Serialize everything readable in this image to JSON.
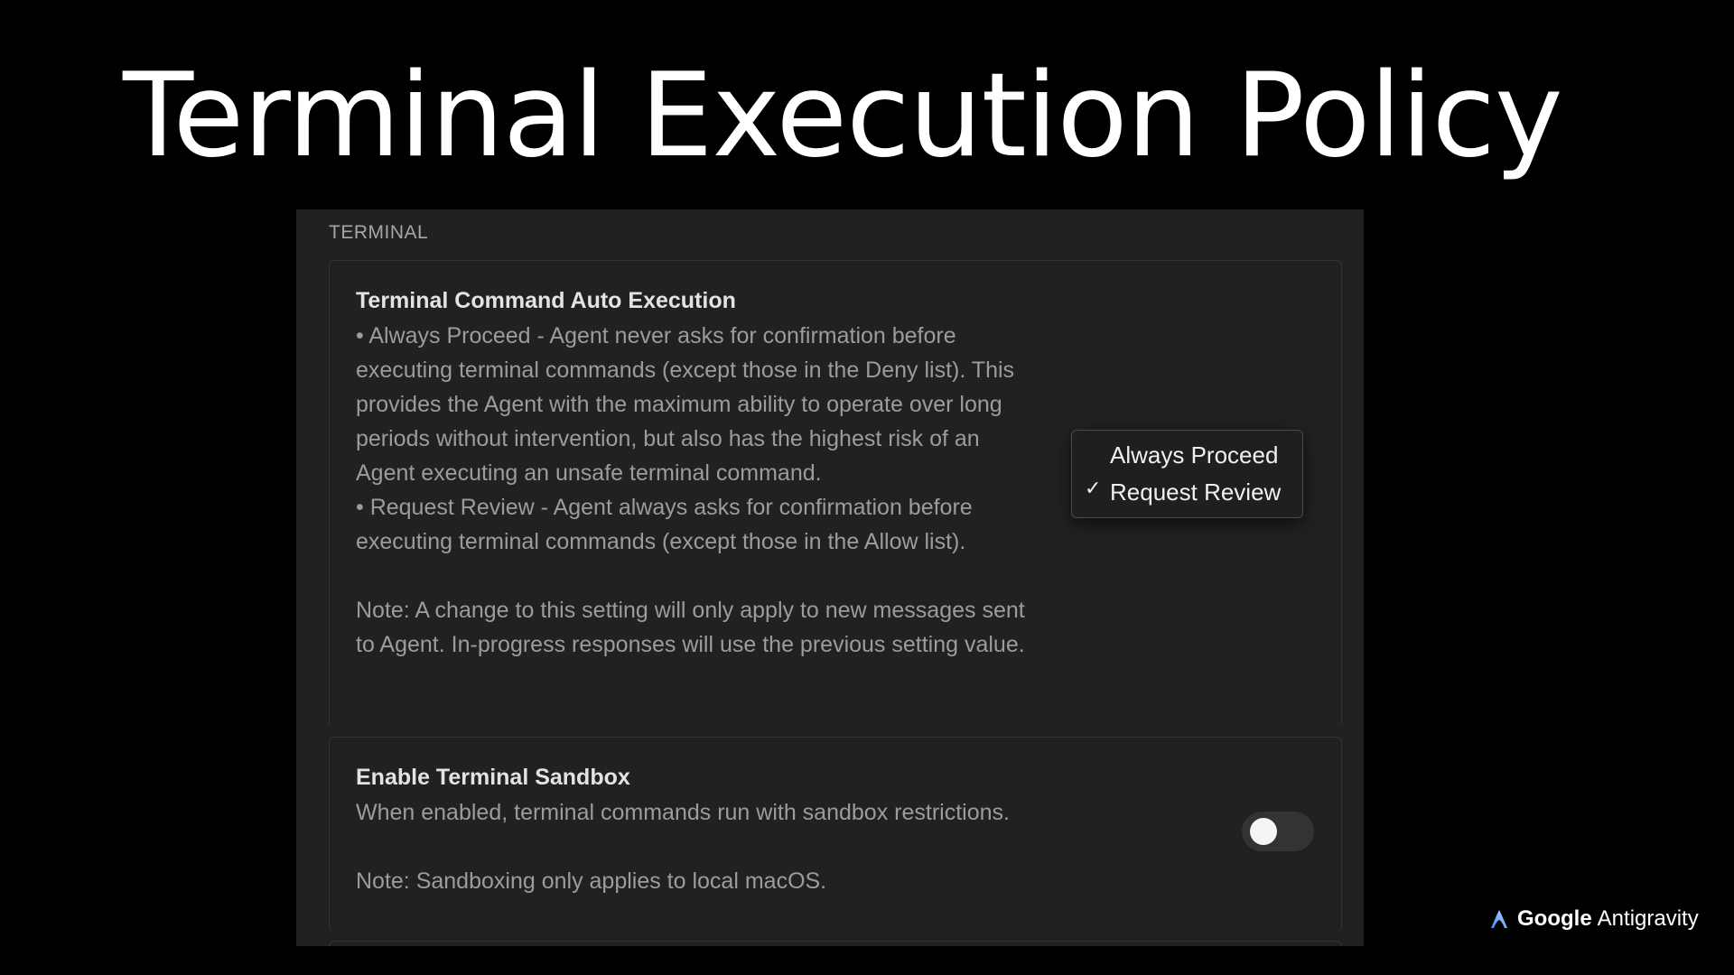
{
  "slide": {
    "title": "Terminal Execution Policy"
  },
  "settings": {
    "section_header": "TERMINAL",
    "auto_execution": {
      "title": "Terminal Command Auto Execution",
      "description_lines": [
        "• Always Proceed - Agent never asks for confirmation before executing terminal commands (except those in the Deny list). This provides the Agent with the maximum ability to operate over long periods without intervention, but also has the highest risk of an Agent executing an unsafe terminal command.",
        "• Request Review - Agent always asks for confirmation before executing terminal commands (except those in the Allow list)."
      ],
      "note": "Note: A change to this setting will only apply to new messages sent to Agent. In-progress responses will use the previous setting value.",
      "dropdown": {
        "options": [
          "Always Proceed",
          "Request Review"
        ],
        "selected": "Request Review",
        "check_mark": "✓"
      }
    },
    "sandbox": {
      "title": "Enable Terminal Sandbox",
      "description": "When enabled, terminal commands run with sandbox restrictions.",
      "note": "Note: Sandboxing only applies to local macOS.",
      "enabled": false
    }
  },
  "brand": {
    "company": "Google",
    "product": "Antigravity",
    "icon": "antigravity-logo-icon",
    "icon_color_start": "#3d8bff",
    "icon_color_end": "#ffffff"
  },
  "colors": {
    "background": "#000000",
    "panel": "#212121",
    "title": "#ffffff",
    "text_primary": "#e3e3e3",
    "text_secondary": "#9c9c9c"
  }
}
